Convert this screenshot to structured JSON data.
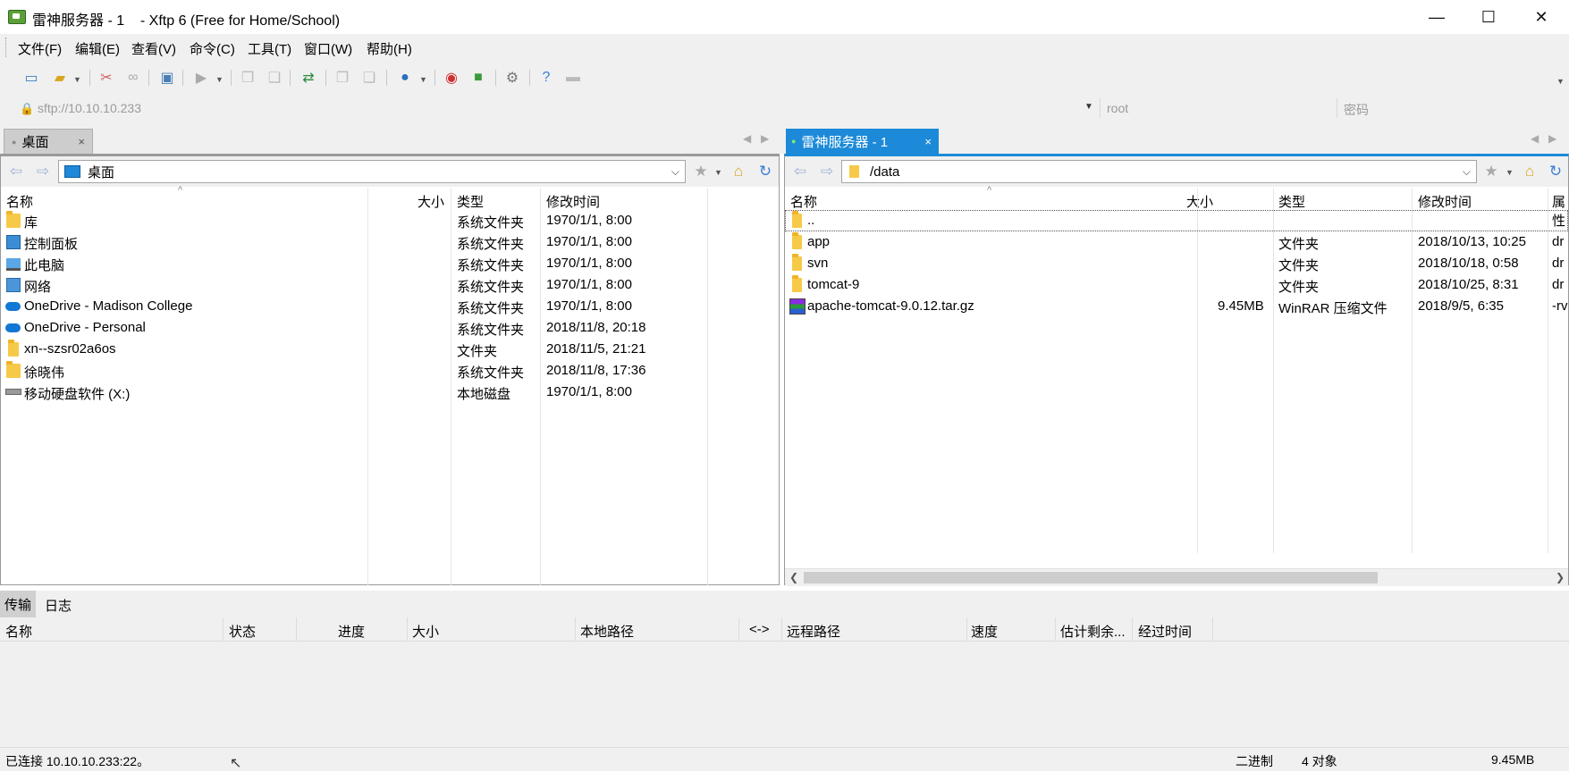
{
  "window": {
    "title": "雷神服务器 - 1    - Xftp 6 (Free for Home/School)",
    "minimize": "—",
    "maximize": "☐",
    "close": "✕"
  },
  "menu": [
    "文件(F)",
    "编辑(E)",
    "查看(V)",
    "命令(C)",
    "工具(T)",
    "窗口(W)",
    "帮助(H)"
  ],
  "toolbar": {
    "icons": [
      "new-session-icon",
      "open-folder-icon",
      "disconnect-icon",
      "reconnect-icon",
      "session-properties-icon",
      "terminal-icon",
      "copy-icon",
      "paste-icon",
      "transfer-icon",
      "copy-file-icon",
      "paste-file-icon",
      "globe-icon",
      "xshell-icon",
      "xftp-icon",
      "settings-icon",
      "help-icon",
      "chat-icon"
    ]
  },
  "address": {
    "host": "sftp://10.10.10.233",
    "user": "root",
    "password_placeholder": "密码"
  },
  "left_tab": {
    "label": "桌面",
    "close": "×"
  },
  "right_tab": {
    "label": "雷神服务器 - 1",
    "close": "×"
  },
  "left_pane": {
    "path": "桌面",
    "columns": [
      "名称",
      "大小",
      "类型",
      "修改时间"
    ],
    "rows": [
      {
        "name": "库",
        "size": "",
        "type": "系统文件夹",
        "modified": "1970/1/1, 8:00",
        "icon": "library-icon"
      },
      {
        "name": "控制面板",
        "size": "",
        "type": "系统文件夹",
        "modified": "1970/1/1, 8:00",
        "icon": "control-panel-icon"
      },
      {
        "name": "此电脑",
        "size": "",
        "type": "系统文件夹",
        "modified": "1970/1/1, 8:00",
        "icon": "computer-icon"
      },
      {
        "name": "网络",
        "size": "",
        "type": "系统文件夹",
        "modified": "1970/1/1, 8:00",
        "icon": "network-icon"
      },
      {
        "name": "OneDrive - Madison College",
        "size": "",
        "type": "系统文件夹",
        "modified": "1970/1/1, 8:00",
        "icon": "onedrive-icon"
      },
      {
        "name": "OneDrive - Personal",
        "size": "",
        "type": "系统文件夹",
        "modified": "2018/11/8, 20:18",
        "icon": "onedrive-icon"
      },
      {
        "name": "xn--szsr02a6os",
        "size": "",
        "type": "文件夹",
        "modified": "2018/11/5, 21:21",
        "icon": "folder-icon"
      },
      {
        "name": "徐晓伟",
        "size": "",
        "type": "系统文件夹",
        "modified": "2018/11/8, 17:36",
        "icon": "user-folder-icon"
      },
      {
        "name": "移动硬盘软件 (X:)",
        "size": "",
        "type": "本地磁盘",
        "modified": "1970/1/1, 8:00",
        "icon": "drive-icon"
      }
    ]
  },
  "right_pane": {
    "path": "/data",
    "columns": [
      "名称",
      "大小",
      "类型",
      "修改时间",
      "属性"
    ],
    "rows": [
      {
        "name": "..",
        "size": "",
        "type": "",
        "modified": "",
        "attr": "",
        "icon": "folder-icon"
      },
      {
        "name": "app",
        "size": "",
        "type": "文件夹",
        "modified": "2018/10/13, 10:25",
        "attr": "dr",
        "icon": "folder-icon"
      },
      {
        "name": "svn",
        "size": "",
        "type": "文件夹",
        "modified": "2018/10/18, 0:58",
        "attr": "dr",
        "icon": "folder-icon"
      },
      {
        "name": "tomcat-9",
        "size": "",
        "type": "文件夹",
        "modified": "2018/10/25, 8:31",
        "attr": "dr",
        "icon": "folder-icon"
      },
      {
        "name": "apache-tomcat-9.0.12.tar.gz",
        "size": "9.45MB",
        "type": "WinRAR 压缩文件",
        "modified": "2018/9/5, 6:35",
        "attr": "-rv",
        "icon": "winrar-icon"
      }
    ]
  },
  "bottom": {
    "tabs": [
      "传输",
      "日志"
    ],
    "columns": [
      "名称",
      "状态",
      "进度",
      "大小",
      "本地路径",
      "<->",
      "远程路径",
      "速度",
      "估计剩余...",
      "经过时间"
    ]
  },
  "status": {
    "connection": "已连接 10.10.10.233:22。",
    "mode": "二进制",
    "objects": "4 对象",
    "size": "9.45MB"
  }
}
